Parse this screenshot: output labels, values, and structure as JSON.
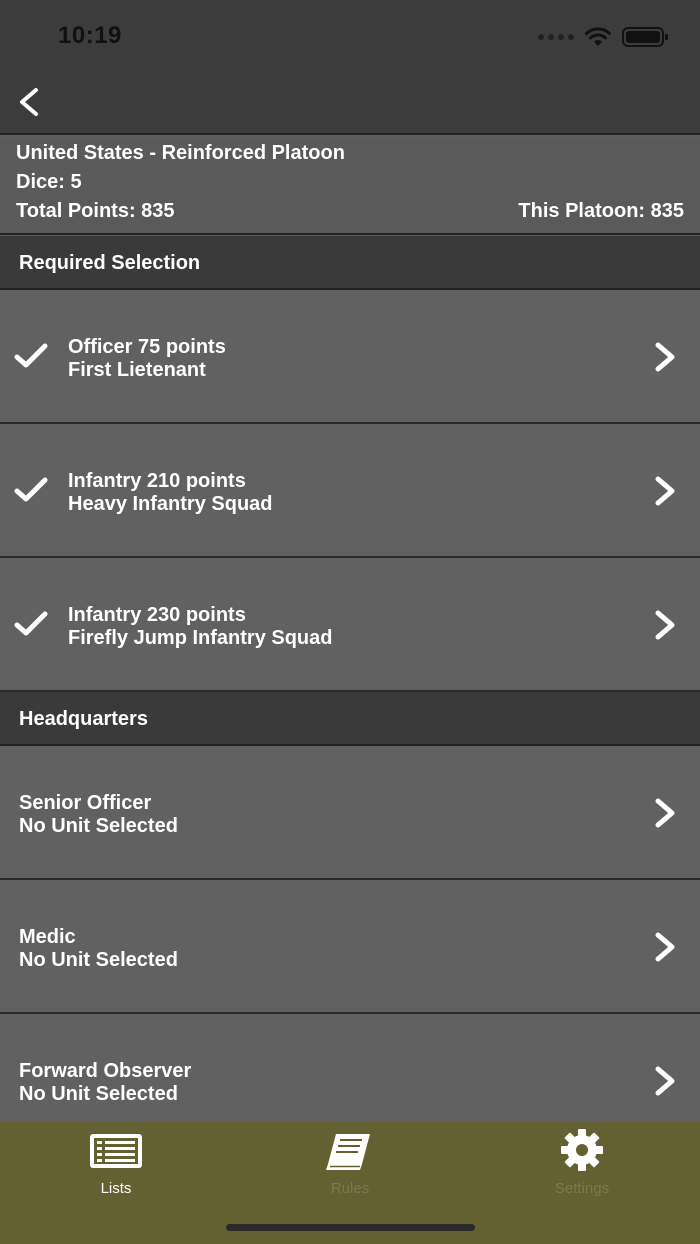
{
  "status": {
    "time": "10:19"
  },
  "summary": {
    "title": "United States - Reinforced Platoon",
    "dice": "Dice: 5",
    "total_points": "Total Points: 835",
    "this_platoon": "This Platoon: 835"
  },
  "sections": {
    "required": "Required Selection",
    "headquarters": "Headquarters"
  },
  "required_rows": [
    {
      "line1": "Officer  75 points",
      "line2": "First Lietenant"
    },
    {
      "line1": "Infantry  210 points",
      "line2": "Heavy Infantry Squad"
    },
    {
      "line1": "Infantry  230 points",
      "line2": "Firefly Jump Infantry Squad"
    }
  ],
  "hq_rows": [
    {
      "line1": "Senior Officer",
      "line2": "No Unit Selected"
    },
    {
      "line1": "Medic",
      "line2": "No Unit Selected"
    },
    {
      "line1": "Forward Observer",
      "line2": "No Unit Selected"
    }
  ],
  "tabs": [
    {
      "label": "Lists",
      "icon": "list-icon",
      "active": true
    },
    {
      "label": "Rules",
      "icon": "book-icon",
      "active": false
    },
    {
      "label": "Settings",
      "icon": "gear-icon",
      "active": false
    }
  ],
  "colors": {
    "row_bg": "#616161",
    "header_bg": "#3a3a3a",
    "tab_bar_bg": "#636132"
  }
}
